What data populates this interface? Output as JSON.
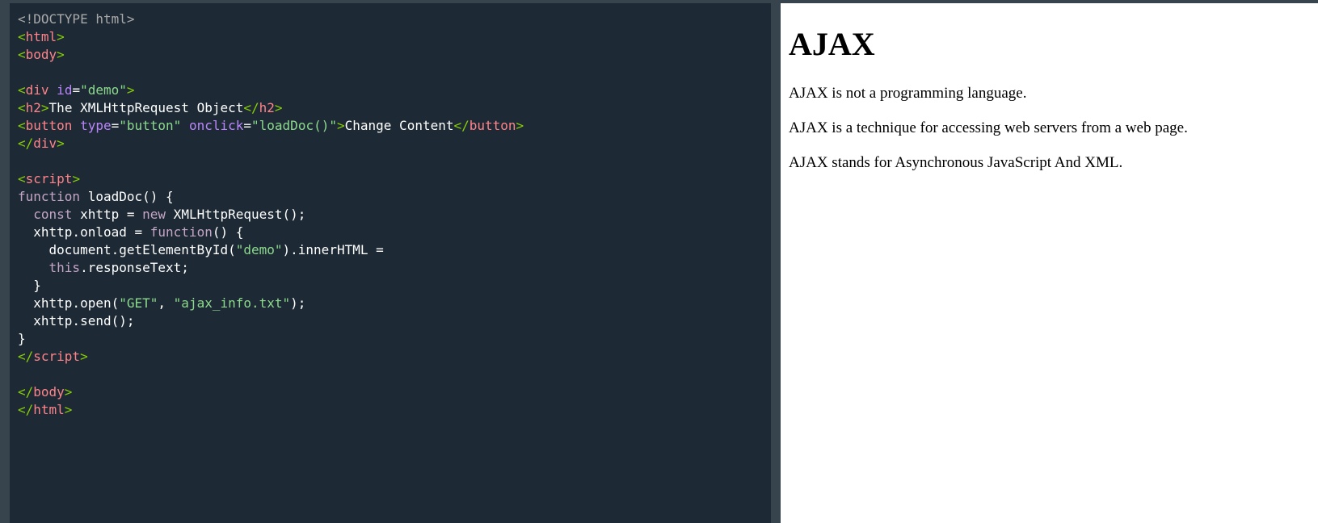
{
  "editor": {
    "lines": [
      [
        {
          "t": "<!DOCTYPE html>",
          "c": "doctype"
        }
      ],
      [
        {
          "t": "<",
          "c": "bracket"
        },
        {
          "t": "html",
          "c": "tag"
        },
        {
          "t": ">",
          "c": "bracket"
        }
      ],
      [
        {
          "t": "<",
          "c": "bracket"
        },
        {
          "t": "body",
          "c": "tag"
        },
        {
          "t": ">",
          "c": "bracket"
        }
      ],
      [],
      [
        {
          "t": "<",
          "c": "bracket"
        },
        {
          "t": "div",
          "c": "tag"
        },
        {
          "t": " id",
          "c": "attr"
        },
        {
          "t": "=",
          "c": "text"
        },
        {
          "t": "\"demo\"",
          "c": "val"
        },
        {
          "t": ">",
          "c": "bracket"
        }
      ],
      [
        {
          "t": "<",
          "c": "bracket"
        },
        {
          "t": "h2",
          "c": "tag"
        },
        {
          "t": ">",
          "c": "bracket"
        },
        {
          "t": "The XMLHttpRequest Object",
          "c": "text"
        },
        {
          "t": "</",
          "c": "bracket"
        },
        {
          "t": "h2",
          "c": "tag"
        },
        {
          "t": ">",
          "c": "bracket"
        }
      ],
      [
        {
          "t": "<",
          "c": "bracket"
        },
        {
          "t": "button",
          "c": "tag"
        },
        {
          "t": " type",
          "c": "attr"
        },
        {
          "t": "=",
          "c": "text"
        },
        {
          "t": "\"button\"",
          "c": "val"
        },
        {
          "t": " onclick",
          "c": "attr"
        },
        {
          "t": "=",
          "c": "text"
        },
        {
          "t": "\"loadDoc()\"",
          "c": "val"
        },
        {
          "t": ">",
          "c": "bracket"
        },
        {
          "t": "Change Content",
          "c": "text"
        },
        {
          "t": "</",
          "c": "bracket"
        },
        {
          "t": "button",
          "c": "tag"
        },
        {
          "t": ">",
          "c": "bracket"
        }
      ],
      [
        {
          "t": "</",
          "c": "bracket"
        },
        {
          "t": "div",
          "c": "tag"
        },
        {
          "t": ">",
          "c": "bracket"
        }
      ],
      [],
      [
        {
          "t": "<",
          "c": "bracket"
        },
        {
          "t": "script",
          "c": "tag"
        },
        {
          "t": ">",
          "c": "bracket"
        }
      ],
      [
        {
          "t": "function",
          "c": "kw"
        },
        {
          "t": " loadDoc() {",
          "c": "text"
        }
      ],
      [
        {
          "t": "  ",
          "c": "text"
        },
        {
          "t": "const",
          "c": "kw"
        },
        {
          "t": " xhttp = ",
          "c": "text"
        },
        {
          "t": "new",
          "c": "kw"
        },
        {
          "t": " XMLHttpRequest();",
          "c": "text"
        }
      ],
      [
        {
          "t": "  xhttp.onload = ",
          "c": "text"
        },
        {
          "t": "function",
          "c": "kw"
        },
        {
          "t": "() {",
          "c": "text"
        }
      ],
      [
        {
          "t": "    document.getElementById(",
          "c": "text"
        },
        {
          "t": "\"demo\"",
          "c": "val"
        },
        {
          "t": ").innerHTML =",
          "c": "text"
        }
      ],
      [
        {
          "t": "    ",
          "c": "text"
        },
        {
          "t": "this",
          "c": "kw"
        },
        {
          "t": ".responseText;",
          "c": "text"
        }
      ],
      [
        {
          "t": "  }",
          "c": "text"
        }
      ],
      [
        {
          "t": "  xhttp.open(",
          "c": "text"
        },
        {
          "t": "\"GET\"",
          "c": "val"
        },
        {
          "t": ", ",
          "c": "text"
        },
        {
          "t": "\"ajax_info.txt\"",
          "c": "val"
        },
        {
          "t": ");",
          "c": "text"
        }
      ],
      [
        {
          "t": "  xhttp.send();",
          "c": "text"
        }
      ],
      [
        {
          "t": "}",
          "c": "text"
        }
      ],
      [
        {
          "t": "</",
          "c": "bracket"
        },
        {
          "t": "script",
          "c": "tag"
        },
        {
          "t": ">",
          "c": "bracket"
        }
      ],
      [],
      [
        {
          "t": "</",
          "c": "bracket"
        },
        {
          "t": "body",
          "c": "tag"
        },
        {
          "t": ">",
          "c": "bracket"
        }
      ],
      [
        {
          "t": "</",
          "c": "bracket"
        },
        {
          "t": "html",
          "c": "tag"
        },
        {
          "t": ">",
          "c": "bracket"
        }
      ]
    ],
    "colors": {
      "background": "#1d2a35",
      "tag": "#ff8389",
      "bracket": "#88ce02",
      "attr": "#bb86fc",
      "value": "#8cd98c",
      "keyword": "#c5a5c5",
      "doctype": "#a9a9a9",
      "text": "#ffffff"
    }
  },
  "result": {
    "heading": "AJAX",
    "paragraphs": [
      "AJAX is not a programming language.",
      "AJAX is a technique for accessing web servers from a web page.",
      "AJAX stands for Asynchronous JavaScript And XML."
    ]
  }
}
